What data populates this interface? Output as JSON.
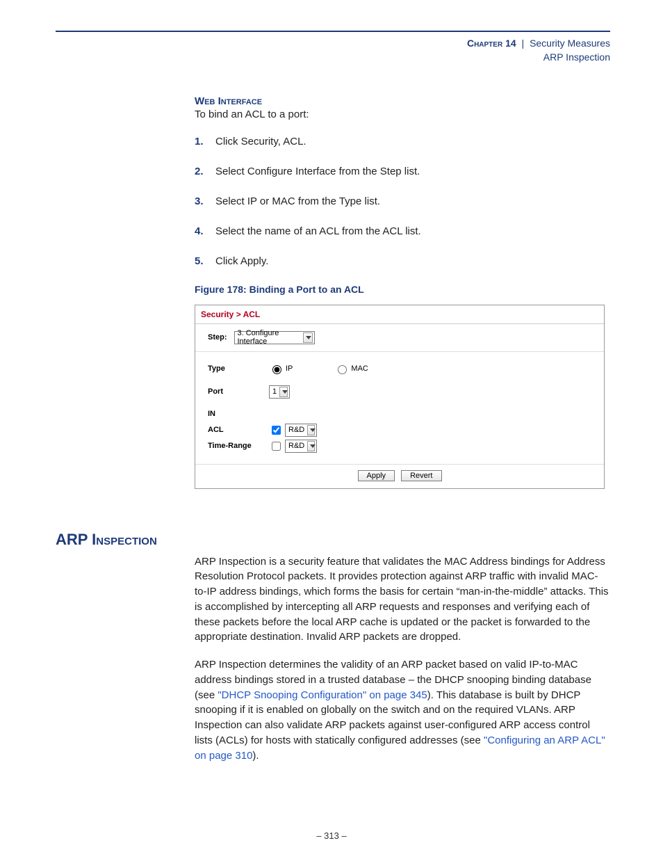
{
  "header": {
    "chapter": "Chapter 14",
    "sep": "|",
    "title": "Security Measures",
    "subtitle": "ARP Inspection"
  },
  "section": {
    "web_interface_label": "Web Interface",
    "lead": "To bind an ACL to a port:",
    "steps": [
      "Click Security, ACL.",
      "Select Configure Interface from the Step list.",
      "Select IP or MAC from the Type list.",
      "Select the name of an ACL from the ACL list.",
      "Click Apply."
    ],
    "figure_caption": "Figure 178:  Binding a Port to an ACL"
  },
  "ui": {
    "breadcrumb": "Security > ACL",
    "step_label": "Step:",
    "step_value": "3. Configure Interface",
    "type_label": "Type",
    "type_ip": "IP",
    "type_mac": "MAC",
    "port_label": "Port",
    "port_value": "1",
    "in_label": "IN",
    "acl_label": "ACL",
    "acl_value": "R&D",
    "timerange_label": "Time-Range",
    "timerange_value": "R&D",
    "apply_btn": "Apply",
    "revert_btn": "Revert"
  },
  "arp": {
    "heading": "ARP Inspection",
    "p1": "ARP Inspection is a security feature that validates the MAC Address bindings for Address Resolution Protocol packets. It provides protection against ARP traffic with invalid MAC-to-IP address bindings, which forms the basis for certain “man-in-the-middle” attacks. This is accomplished by intercepting all ARP requests and responses and verifying each of these packets before the local ARP cache is updated or the packet is forwarded to the appropriate destination. Invalid ARP packets are dropped.",
    "p2_a": "ARP Inspection determines the validity of an ARP packet based on valid IP-to-MAC address bindings stored in a trusted database – the DHCP snooping binding database (see ",
    "p2_link1": "\"DHCP Snooping Configuration\" on page 345",
    "p2_b": "). This database is built by DHCP snooping if it is enabled on globally on the switch and on the required VLANs. ARP Inspection can also validate ARP packets against user-configured ARP access control lists (ACLs) for hosts with statically configured addresses (see ",
    "p2_link2": "\"Configuring an ARP ACL\" on page 310",
    "p2_c": ")."
  },
  "footer": {
    "page": "–  313  –"
  }
}
